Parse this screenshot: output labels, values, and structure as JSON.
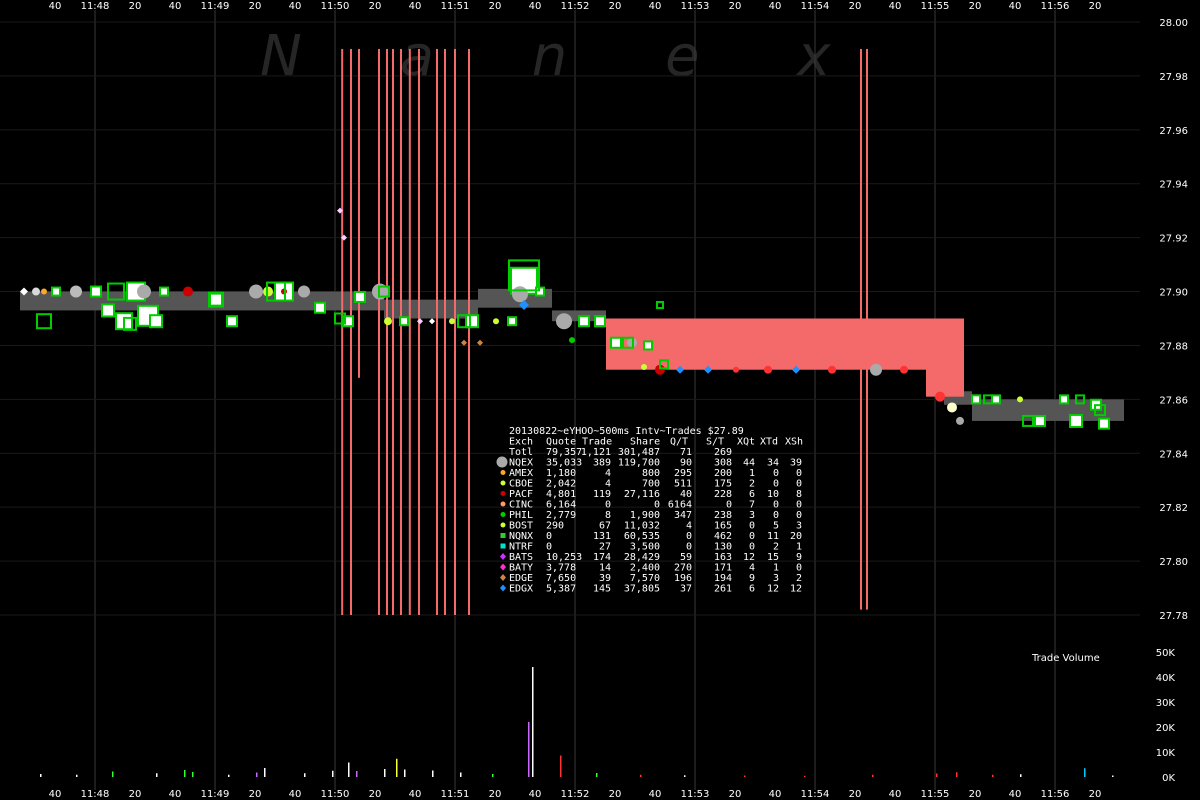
{
  "watermark": "N a n e x",
  "chart_data": {
    "type": "scatter",
    "symbol": "eYHOO",
    "date": "20130822",
    "price_axis": {
      "min": 27.78,
      "max": 28.0,
      "ticks": [
        "28.00",
        "27.98",
        "27.96",
        "27.94",
        "27.92",
        "27.90",
        "27.88",
        "27.86",
        "27.84",
        "27.82",
        "27.80",
        "27.78"
      ]
    },
    "volume_axis": {
      "label": "Trade Volume",
      "max": 50000,
      "ticks": [
        "50K",
        "40K",
        "30K",
        "20K",
        "10K",
        "0K"
      ]
    },
    "time_axis": {
      "labels": [
        "40",
        "11:48",
        "20",
        "40",
        "11:49",
        "20",
        "40",
        "11:50",
        "20",
        "40",
        "11:51",
        "20",
        "40",
        "11:52",
        "20",
        "40",
        "11:53",
        "20",
        "40",
        "11:54",
        "20",
        "40",
        "11:55",
        "20",
        "40",
        "11:56",
        "20"
      ]
    },
    "nbbo_band": [
      {
        "t0": 0.0,
        "t1": 8.9,
        "bid": 27.893,
        "ask": 27.9
      },
      {
        "t0": 8.9,
        "t1": 9.1,
        "bid": 27.893,
        "ask": 27.901
      },
      {
        "t0": 9.1,
        "t1": 11.45,
        "bid": 27.89,
        "ask": 27.897
      },
      {
        "t0": 11.45,
        "t1": 13.3,
        "bid": 27.894,
        "ask": 27.901
      },
      {
        "t0": 13.3,
        "t1": 14.65,
        "bid": 27.889,
        "ask": 27.893
      },
      {
        "t0": 23.1,
        "t1": 23.8,
        "bid": 27.858,
        "ask": 27.863
      },
      {
        "t0": 23.8,
        "t1": 27.6,
        "bid": 27.852,
        "ask": 27.86
      }
    ],
    "spread_red": [
      {
        "t0": 14.65,
        "t1": 22.65,
        "bid": 27.871,
        "ask": 27.89
      },
      {
        "t0": 22.65,
        "t1": 23.6,
        "bid": 27.861,
        "ask": 27.89
      }
    ],
    "spikes": [
      {
        "t": 8.03,
        "lo": 27.78,
        "hi": 27.99
      },
      {
        "t": 8.25,
        "lo": 27.78,
        "hi": 27.99
      },
      {
        "t": 8.45,
        "lo": 27.868,
        "hi": 27.99
      },
      {
        "t": 8.95,
        "lo": 27.78,
        "hi": 27.99
      },
      {
        "t": 9.15,
        "lo": 27.78,
        "hi": 27.99
      },
      {
        "t": 9.3,
        "lo": 27.78,
        "hi": 27.99
      },
      {
        "t": 9.5,
        "lo": 27.78,
        "hi": 27.99
      },
      {
        "t": 9.72,
        "lo": 27.78,
        "hi": 27.99
      },
      {
        "t": 9.95,
        "lo": 27.78,
        "hi": 27.99
      },
      {
        "t": 10.4,
        "lo": 27.78,
        "hi": 27.99
      },
      {
        "t": 10.6,
        "lo": 27.78,
        "hi": 27.99
      },
      {
        "t": 10.85,
        "lo": 27.78,
        "hi": 27.99
      },
      {
        "t": 11.2,
        "lo": 27.78,
        "hi": 27.99
      },
      {
        "t": 21.0,
        "lo": 27.782,
        "hi": 27.99
      },
      {
        "t": 21.15,
        "lo": 27.782,
        "hi": 27.99
      }
    ],
    "trades": [
      {
        "t": 0.1,
        "p": 27.9,
        "c": "#ffffff",
        "s": 4,
        "m": "diamond"
      },
      {
        "t": 0.4,
        "p": 27.9,
        "c": "#d9d9d9",
        "s": 4,
        "m": "circle"
      },
      {
        "t": 0.6,
        "p": 27.9,
        "c": "#f7a72a",
        "s": 3,
        "m": "circle"
      },
      {
        "t": 0.9,
        "p": 27.9,
        "c": "#ffffff",
        "s": 4,
        "m": "square"
      },
      {
        "t": 1.4,
        "p": 27.9,
        "c": "#bbbbbb",
        "s": 6,
        "m": "circle"
      },
      {
        "t": 1.9,
        "p": 27.9,
        "c": "#ffffff",
        "s": 5,
        "m": "square"
      },
      {
        "t": 2.2,
        "p": 27.893,
        "c": "#ffffff",
        "s": 6,
        "m": "square"
      },
      {
        "t": 2.6,
        "p": 27.889,
        "c": "#ffffff",
        "s": 8,
        "m": "square"
      },
      {
        "t": 2.9,
        "p": 27.9,
        "c": "#ffffff",
        "s": 9,
        "m": "square"
      },
      {
        "t": 3.1,
        "p": 27.9,
        "c": "#aaaaaa",
        "s": 7,
        "m": "circle"
      },
      {
        "t": 3.2,
        "p": 27.891,
        "c": "#ffffff",
        "s": 10,
        "m": "square"
      },
      {
        "t": 3.4,
        "p": 27.889,
        "c": "#ffffff",
        "s": 6,
        "m": "square"
      },
      {
        "t": 3.6,
        "p": 27.9,
        "c": "#ffffff",
        "s": 4,
        "m": "square"
      },
      {
        "t": 4.2,
        "p": 27.9,
        "c": "#cc0000",
        "s": 5,
        "m": "circle"
      },
      {
        "t": 4.9,
        "p": 27.897,
        "c": "#ffffff",
        "s": 7,
        "m": "square"
      },
      {
        "t": 5.3,
        "p": 27.889,
        "c": "#ffffff",
        "s": 5,
        "m": "square"
      },
      {
        "t": 5.9,
        "p": 27.9,
        "c": "#aaaaaa",
        "s": 7,
        "m": "circle"
      },
      {
        "t": 6.2,
        "p": 27.9,
        "c": "#ccff33",
        "s": 5,
        "m": "circle"
      },
      {
        "t": 6.6,
        "p": 27.9,
        "c": "#ffffff",
        "s": 9,
        "m": "square"
      },
      {
        "t": 6.6,
        "p": 27.9,
        "c": "#cc0000",
        "s": 3,
        "m": "circle"
      },
      {
        "t": 7.1,
        "p": 27.9,
        "c": "#aaaaaa",
        "s": 6,
        "m": "circle"
      },
      {
        "t": 7.5,
        "p": 27.894,
        "c": "#ffffff",
        "s": 5,
        "m": "square"
      },
      {
        "t": 8.0,
        "p": 27.93,
        "c": "#ffccff",
        "s": 3,
        "m": "diamond"
      },
      {
        "t": 8.1,
        "p": 27.92,
        "c": "#ffccff",
        "s": 3,
        "m": "diamond"
      },
      {
        "t": 8.2,
        "p": 27.889,
        "c": "#ffffff",
        "s": 5,
        "m": "square"
      },
      {
        "t": 8.5,
        "p": 27.898,
        "c": "#ffffff",
        "s": 5,
        "m": "square"
      },
      {
        "t": 9.0,
        "p": 27.9,
        "c": "#aaaaaa",
        "s": 8,
        "m": "circle"
      },
      {
        "t": 9.2,
        "p": 27.889,
        "c": "#ccff33",
        "s": 4,
        "m": "circle"
      },
      {
        "t": 9.6,
        "p": 27.889,
        "c": "#ffffff",
        "s": 4,
        "m": "square"
      },
      {
        "t": 10.0,
        "p": 27.889,
        "c": "#ffccff",
        "s": 3,
        "m": "diamond"
      },
      {
        "t": 10.3,
        "p": 27.889,
        "c": "#ffffff",
        "s": 3,
        "m": "diamond"
      },
      {
        "t": 10.8,
        "p": 27.889,
        "c": "#ccff33",
        "s": 3,
        "m": "circle"
      },
      {
        "t": 11.3,
        "p": 27.889,
        "c": "#ffffff",
        "s": 6,
        "m": "square"
      },
      {
        "t": 11.1,
        "p": 27.881,
        "c": "#cd853f",
        "s": 3,
        "m": "diamond"
      },
      {
        "t": 11.5,
        "p": 27.881,
        "c": "#cd853f",
        "s": 3,
        "m": "diamond"
      },
      {
        "t": 11.9,
        "p": 27.889,
        "c": "#ccff33",
        "s": 3,
        "m": "circle"
      },
      {
        "t": 12.3,
        "p": 27.889,
        "c": "#ffffff",
        "s": 4,
        "m": "square"
      },
      {
        "t": 12.6,
        "p": 27.904,
        "c": "#ffffff",
        "s": 13,
        "m": "square"
      },
      {
        "t": 12.5,
        "p": 27.899,
        "c": "#aaaaaa",
        "s": 8,
        "m": "circle"
      },
      {
        "t": 12.6,
        "p": 27.895,
        "c": "#1e90ff",
        "s": 5,
        "m": "diamond"
      },
      {
        "t": 13.0,
        "p": 27.9,
        "c": "#ffffff",
        "s": 4,
        "m": "square"
      },
      {
        "t": 13.6,
        "p": 27.889,
        "c": "#aaaaaa",
        "s": 8,
        "m": "circle"
      },
      {
        "t": 13.8,
        "p": 27.882,
        "c": "#00cc00",
        "s": 3,
        "m": "circle"
      },
      {
        "t": 14.1,
        "p": 27.889,
        "c": "#ffffff",
        "s": 5,
        "m": "square"
      },
      {
        "t": 14.5,
        "p": 27.889,
        "c": "#ffffff",
        "s": 5,
        "m": "square"
      },
      {
        "t": 14.9,
        "p": 27.881,
        "c": "#ffffff",
        "s": 5,
        "m": "square"
      },
      {
        "t": 15.3,
        "p": 27.881,
        "c": "#aaaaaa",
        "s": 5,
        "m": "circle"
      },
      {
        "t": 15.7,
        "p": 27.88,
        "c": "#ffffff",
        "s": 4,
        "m": "square"
      },
      {
        "t": 15.6,
        "p": 27.872,
        "c": "#ccff33",
        "s": 3,
        "m": "circle"
      },
      {
        "t": 16.0,
        "p": 27.871,
        "c": "#cc0000",
        "s": 5,
        "m": "circle"
      },
      {
        "t": 16.5,
        "p": 27.871,
        "c": "#1e90ff",
        "s": 4,
        "m": "diamond"
      },
      {
        "t": 17.2,
        "p": 27.871,
        "c": "#1e90ff",
        "s": 4,
        "m": "diamond"
      },
      {
        "t": 17.9,
        "p": 27.871,
        "c": "#ff3333",
        "s": 3,
        "m": "circle"
      },
      {
        "t": 18.7,
        "p": 27.871,
        "c": "#ff3333",
        "s": 4,
        "m": "circle"
      },
      {
        "t": 19.4,
        "p": 27.871,
        "c": "#1e90ff",
        "s": 4,
        "m": "diamond"
      },
      {
        "t": 20.3,
        "p": 27.871,
        "c": "#ff3333",
        "s": 4,
        "m": "circle"
      },
      {
        "t": 21.4,
        "p": 27.871,
        "c": "#aaaaaa",
        "s": 6,
        "m": "circle"
      },
      {
        "t": 22.1,
        "p": 27.871,
        "c": "#ff3333",
        "s": 4,
        "m": "circle"
      },
      {
        "t": 23.0,
        "p": 27.861,
        "c": "#ff3333",
        "s": 5,
        "m": "circle"
      },
      {
        "t": 23.3,
        "p": 27.857,
        "c": "#ffffcc",
        "s": 5,
        "m": "circle"
      },
      {
        "t": 23.5,
        "p": 27.852,
        "c": "#aaaaaa",
        "s": 4,
        "m": "circle"
      },
      {
        "t": 23.9,
        "p": 27.86,
        "c": "#ffffff",
        "s": 4,
        "m": "square"
      },
      {
        "t": 24.4,
        "p": 27.86,
        "c": "#ffffff",
        "s": 4,
        "m": "square"
      },
      {
        "t": 25.0,
        "p": 27.86,
        "c": "#ccff33",
        "s": 3,
        "m": "circle"
      },
      {
        "t": 25.5,
        "p": 27.852,
        "c": "#ffffff",
        "s": 5,
        "m": "square"
      },
      {
        "t": 26.1,
        "p": 27.86,
        "c": "#ffffff",
        "s": 4,
        "m": "square"
      },
      {
        "t": 26.4,
        "p": 27.852,
        "c": "#ffffff",
        "s": 6,
        "m": "square"
      },
      {
        "t": 26.9,
        "p": 27.858,
        "c": "#ffffff",
        "s": 5,
        "m": "square"
      },
      {
        "t": 27.1,
        "p": 27.851,
        "c": "#ffffff",
        "s": 5,
        "m": "square"
      }
    ],
    "green_outline_trades": [
      {
        "t": 0.6,
        "p": 27.889,
        "s": 7
      },
      {
        "t": 2.4,
        "p": 27.9,
        "s": 8
      },
      {
        "t": 2.75,
        "p": 27.888,
        "s": 6
      },
      {
        "t": 4.9,
        "p": 27.897,
        "s": 6
      },
      {
        "t": 6.4,
        "p": 27.9,
        "s": 9
      },
      {
        "t": 8.0,
        "p": 27.89,
        "s": 5
      },
      {
        "t": 9.1,
        "p": 27.9,
        "s": 5
      },
      {
        "t": 11.1,
        "p": 27.889,
        "s": 6
      },
      {
        "t": 12.6,
        "p": 27.906,
        "s": 15
      },
      {
        "t": 14.5,
        "p": 27.889,
        "s": 5
      },
      {
        "t": 15.2,
        "p": 27.881,
        "s": 5
      },
      {
        "t": 16.1,
        "p": 27.873,
        "s": 4
      },
      {
        "t": 16.0,
        "p": 27.895,
        "s": 3
      },
      {
        "t": 24.2,
        "p": 27.86,
        "s": 4
      },
      {
        "t": 25.2,
        "p": 27.852,
        "s": 5
      },
      {
        "t": 26.5,
        "p": 27.86,
        "s": 4
      },
      {
        "t": 27.0,
        "p": 27.856,
        "s": 5
      }
    ],
    "volume_bars": [
      {
        "t": 0.5,
        "v": 1200,
        "c": "#ffffff"
      },
      {
        "t": 1.4,
        "v": 900,
        "c": "#ffffff"
      },
      {
        "t": 2.3,
        "v": 2200,
        "c": "#33ff33"
      },
      {
        "t": 3.4,
        "v": 1500,
        "c": "#ffffff"
      },
      {
        "t": 4.1,
        "v": 2800,
        "c": "#33ff33"
      },
      {
        "t": 4.3,
        "v": 2000,
        "c": "#33ff33"
      },
      {
        "t": 5.2,
        "v": 900,
        "c": "#ffffff"
      },
      {
        "t": 5.9,
        "v": 1800,
        "c": "#cc66ff"
      },
      {
        "t": 6.1,
        "v": 3600,
        "c": "#ffffff"
      },
      {
        "t": 7.1,
        "v": 1500,
        "c": "#ffffff"
      },
      {
        "t": 7.8,
        "v": 2500,
        "c": "#ffffff"
      },
      {
        "t": 8.2,
        "v": 5800,
        "c": "#ffffff"
      },
      {
        "t": 8.4,
        "v": 2400,
        "c": "#cc66ff"
      },
      {
        "t": 9.1,
        "v": 3200,
        "c": "#ffffff"
      },
      {
        "t": 9.4,
        "v": 7300,
        "c": "#ffff33"
      },
      {
        "t": 9.6,
        "v": 3000,
        "c": "#ffffff"
      },
      {
        "t": 10.3,
        "v": 2600,
        "c": "#ffffff"
      },
      {
        "t": 11.0,
        "v": 1800,
        "c": "#ffffff"
      },
      {
        "t": 11.8,
        "v": 1200,
        "c": "#33ff33"
      },
      {
        "t": 12.7,
        "v": 22000,
        "c": "#cc66ff"
      },
      {
        "t": 12.8,
        "v": 44000,
        "c": "#ffffff"
      },
      {
        "t": 13.5,
        "v": 8600,
        "c": "#ff3333"
      },
      {
        "t": 14.4,
        "v": 1600,
        "c": "#33ff33"
      },
      {
        "t": 15.5,
        "v": 900,
        "c": "#ff3333"
      },
      {
        "t": 16.6,
        "v": 700,
        "c": "#ffffff"
      },
      {
        "t": 18.1,
        "v": 600,
        "c": "#ff3333"
      },
      {
        "t": 19.6,
        "v": 500,
        "c": "#ff3333"
      },
      {
        "t": 21.3,
        "v": 900,
        "c": "#ff3333"
      },
      {
        "t": 22.9,
        "v": 1400,
        "c": "#ff3333"
      },
      {
        "t": 23.4,
        "v": 1900,
        "c": "#ff3333"
      },
      {
        "t": 24.3,
        "v": 900,
        "c": "#ff3333"
      },
      {
        "t": 25.0,
        "v": 1100,
        "c": "#ffffff"
      },
      {
        "t": 26.6,
        "v": 3500,
        "c": "#00ccff"
      },
      {
        "t": 27.3,
        "v": 600,
        "c": "#ffffff"
      }
    ],
    "legend": {
      "title": "20130822~eYHOO~500ms Intv~Trades $27.89",
      "columns": [
        "Exch",
        "Quote",
        "Trade",
        "Share",
        "Q/T",
        "S/T",
        "XQt",
        "XTd",
        "XSh"
      ],
      "rows": [
        {
          "marker": "none",
          "color": "",
          "cells": [
            "Totl",
            "79,357",
            "1,121",
            "301,487",
            "71",
            "269",
            "",
            "",
            ""
          ]
        },
        {
          "marker": "bigcircle",
          "color": "#aaaaaa",
          "cells": [
            "NQEX",
            "35,033",
            "389",
            "119,700",
            "90",
            "308",
            "44",
            "34",
            "39"
          ]
        },
        {
          "marker": "circle",
          "color": "#f7a72a",
          "cells": [
            "AMEX",
            "1,180",
            "4",
            "800",
            "295",
            "200",
            "1",
            "0",
            "0"
          ]
        },
        {
          "marker": "circle",
          "color": "#ccff33",
          "cells": [
            "CBOE",
            "2,042",
            "4",
            "700",
            "511",
            "175",
            "2",
            "0",
            "0"
          ]
        },
        {
          "marker": "circle",
          "color": "#cc0000",
          "cells": [
            "PACF",
            "4,801",
            "119",
            "27,116",
            "40",
            "228",
            "6",
            "10",
            "8"
          ]
        },
        {
          "marker": "circle",
          "color": "#ff9966",
          "cells": [
            "CINC",
            "6,164",
            "0",
            "0",
            "6164",
            "0",
            "7",
            "0",
            "0"
          ]
        },
        {
          "marker": "circle",
          "color": "#00cc00",
          "cells": [
            "PHIL",
            "2,779",
            "8",
            "1,900",
            "347",
            "238",
            "3",
            "0",
            "0"
          ]
        },
        {
          "marker": "circle",
          "color": "#ccff33",
          "cells": [
            "BOST",
            "290",
            "67",
            "11,032",
            "4",
            "165",
            "0",
            "5",
            "3"
          ]
        },
        {
          "marker": "square",
          "color": "#33cc33",
          "cells": [
            "NQNX",
            "0",
            "131",
            "60,535",
            "0",
            "462",
            "0",
            "11",
            "20"
          ]
        },
        {
          "marker": "square",
          "color": "#00e5cc",
          "cells": [
            "NTRF",
            "0",
            "27",
            "3,500",
            "0",
            "130",
            "0",
            "2",
            "1"
          ]
        },
        {
          "marker": "diamond",
          "color": "#cc33ff",
          "cells": [
            "BATS",
            "10,253",
            "174",
            "28,429",
            "59",
            "163",
            "12",
            "15",
            "9"
          ]
        },
        {
          "marker": "diamond",
          "color": "#ff33cc",
          "cells": [
            "BATY",
            "3,778",
            "14",
            "2,400",
            "270",
            "171",
            "4",
            "1",
            "0"
          ]
        },
        {
          "marker": "diamond",
          "color": "#cd853f",
          "cells": [
            "EDGE",
            "7,650",
            "39",
            "7,570",
            "196",
            "194",
            "9",
            "3",
            "2"
          ]
        },
        {
          "marker": "diamond",
          "color": "#1e90ff",
          "cells": [
            "EDGX",
            "5,387",
            "145",
            "37,805",
            "37",
            "261",
            "6",
            "12",
            "12"
          ]
        }
      ]
    },
    "colors": {
      "background": "#000000",
      "nbbo_band": "#555555",
      "wide_spread": "#f46a6a",
      "grid": "#3a3a3a",
      "text": "#ffffff"
    }
  }
}
